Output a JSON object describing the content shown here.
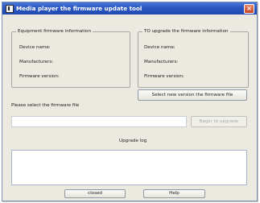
{
  "window": {
    "title": "Media player the firmware update tool",
    "icon": "app-icon",
    "close_symbol": "×"
  },
  "equipment_info": {
    "legend": "Equipment firmware information",
    "device_name_label": "Device name:",
    "manufacturers_label": "Manufacturers:",
    "firmware_version_label": "Firmware version:"
  },
  "upgrade_info": {
    "legend": "TO upgrade the firmware information",
    "device_name_label": "Device name:",
    "manufacturers_label": "Manufacturers:",
    "firmware_version_label": "Firmware version:"
  },
  "buttons": {
    "select_firmware": "Select new version the firmware file",
    "begin_upgrade": "Begin to upgrade",
    "closed": "closed",
    "help": "Help"
  },
  "file_select": {
    "label": "Please select the firmware file",
    "value": ""
  },
  "upgrade_log": {
    "label": "Upgrade log",
    "content": ""
  },
  "colors": {
    "titlebar": "#2b57c4",
    "window_background": "#ece9e0"
  }
}
